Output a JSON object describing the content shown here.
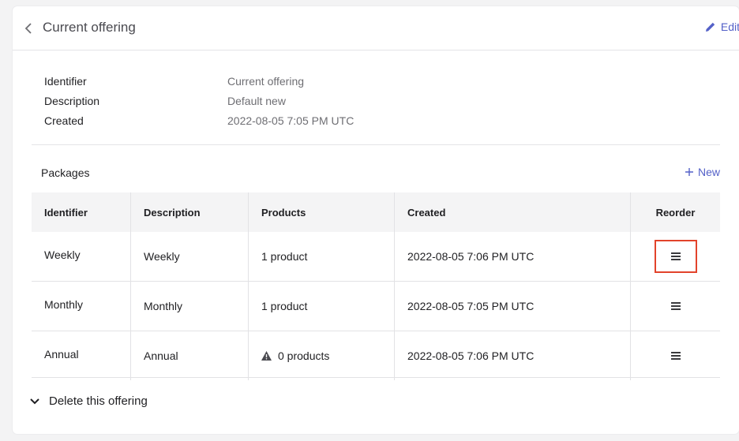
{
  "header": {
    "title": "Current offering",
    "edit_label": "Edit"
  },
  "details": [
    {
      "label": "Identifier",
      "value": "Current offering"
    },
    {
      "label": "Description",
      "value": "Default new"
    },
    {
      "label": "Created",
      "value": "2022-08-05 7:05 PM UTC"
    }
  ],
  "packages": {
    "title": "Packages",
    "new_label": "New",
    "columns": [
      "Identifier",
      "Description",
      "Products",
      "Created",
      "Reorder"
    ],
    "rows": [
      {
        "identifier": "Weekly",
        "description": "Weekly",
        "products": "1 product",
        "created": "2022-08-05 7:06 PM UTC",
        "warning": false
      },
      {
        "identifier": "Monthly",
        "description": "Monthly",
        "products": "1 product",
        "created": "2022-08-05 7:05 PM UTC",
        "warning": false
      },
      {
        "identifier": "Annual",
        "description": "Annual",
        "products": "0 products",
        "created": "2022-08-05 7:06 PM UTC",
        "warning": true
      }
    ]
  },
  "footer": {
    "delete_label": "Delete this offering"
  },
  "colors": {
    "accent": "#5461c8",
    "highlight": "#e2432b"
  }
}
